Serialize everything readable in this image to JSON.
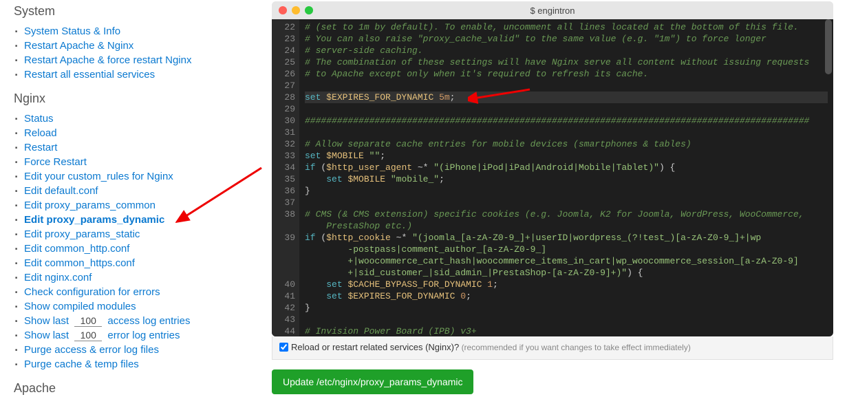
{
  "sidebar": {
    "sections": {
      "system": {
        "title": "System",
        "items": [
          "System Status & Info",
          "Restart Apache & Nginx",
          "Restart Apache & force restart Nginx",
          "Restart all essential services"
        ]
      },
      "nginx": {
        "title": "Nginx",
        "items": [
          "Status",
          "Reload",
          "Restart",
          "Force Restart",
          "Edit your custom_rules for Nginx",
          "Edit default.conf",
          "Edit proxy_params_common",
          "Edit proxy_params_dynamic",
          "Edit proxy_params_static",
          "Edit common_http.conf",
          "Edit common_https.conf",
          "Edit nginx.conf",
          "Check configuration for errors",
          "Show compiled modules"
        ],
        "log_access_before": "Show last",
        "log_access_value": "100",
        "log_access_after": "access log entries",
        "log_error_before": "Show last",
        "log_error_value": "100",
        "log_error_after": "error log entries",
        "purge_items": [
          "Purge access & error log files",
          "Purge cache & temp files"
        ]
      },
      "apache": {
        "title": "Apache"
      }
    }
  },
  "editor": {
    "title": "$ engintron",
    "line_start": 22,
    "line_end": 44,
    "lines": [
      {
        "n": 22,
        "type": "comment",
        "text": "# (set to 1m by default). To enable, uncomment all lines located at the bottom of this file."
      },
      {
        "n": 23,
        "type": "comment",
        "text": "# You can also raise \"proxy_cache_valid\" to the same value (e.g. \"1m\") to force longer"
      },
      {
        "n": 24,
        "type": "comment",
        "text": "# server-side caching."
      },
      {
        "n": 25,
        "type": "comment",
        "text": "# The combination of these settings will have Nginx serve all content without issuing requests"
      },
      {
        "n": 26,
        "type": "comment",
        "text": "# to Apache except only when it's required to refresh its cache."
      },
      {
        "n": 27,
        "type": "blank",
        "text": ""
      },
      {
        "n": 28,
        "type": "set",
        "text_set": "set",
        "text_var": "$EXPIRES_FOR_DYNAMIC",
        "text_val": "5m",
        "highlight": true
      },
      {
        "n": 29,
        "type": "blank",
        "text": ""
      },
      {
        "n": 30,
        "type": "comment-line",
        "text": "##############################################################################################"
      },
      {
        "n": 31,
        "type": "blank",
        "text": ""
      },
      {
        "n": 32,
        "type": "comment",
        "text": "# Allow separate cache entries for mobile devices (smartphones & tables)"
      },
      {
        "n": 33,
        "type": "set",
        "text_set": "set",
        "text_var": "$MOBILE",
        "text_val": "\"\""
      },
      {
        "n": 34,
        "type": "if",
        "text_if": "if",
        "text_cond": "($http_user_agent ~* \"(iPhone|iPod|iPad|Android|Mobile|Tablet)\") {"
      },
      {
        "n": 35,
        "type": "set-indent",
        "text_set": "set",
        "text_var": "$MOBILE",
        "text_val": "\"mobile_\""
      },
      {
        "n": 36,
        "type": "close",
        "text": "}"
      },
      {
        "n": 37,
        "type": "blank",
        "text": ""
      },
      {
        "n": 38,
        "type": "comment",
        "text": "# CMS (& CMS extension) specific cookies (e.g. Joomla, K2 for Joomla, WordPress, WooCommerce, PrestaShop etc.)",
        "wrap": 2
      },
      {
        "n": 39,
        "type": "if-long",
        "text_if": "if",
        "text_cond": "($http_cookie ~* \"(joomla_[a-zA-Z0-9_]+|userID|wordpress_(?!test_)[a-zA-Z0-9_]+|wp-postpass|comment_author_[a-zA-Z0-9_]+|woocommerce_cart_hash|woocommerce_items_in_cart|wp_woocommerce_session_[a-zA-Z0-9]+|sid_customer_|sid_admin_|PrestaShop-[a-zA-Z0-9]+)\") {",
        "wrap": 4
      },
      {
        "n": 40,
        "type": "set-indent",
        "text_set": "set",
        "text_var": "$CACHE_BYPASS_FOR_DYNAMIC",
        "text_val": "1"
      },
      {
        "n": 41,
        "type": "set-indent",
        "text_set": "set",
        "text_var": "$EXPIRES_FOR_DYNAMIC",
        "text_val": "0"
      },
      {
        "n": 42,
        "type": "close",
        "text": "}"
      },
      {
        "n": 43,
        "type": "blank",
        "text": ""
      },
      {
        "n": 44,
        "type": "comment",
        "text": "# Invision Power Board (IPB) v3+"
      }
    ]
  },
  "footer": {
    "checkbox_label": "Reload or restart related services (Nginx)?",
    "checkbox_hint": "(recommended if you want changes to take effect immediately)",
    "button_label": "Update /etc/nginx/proxy_params_dynamic"
  }
}
